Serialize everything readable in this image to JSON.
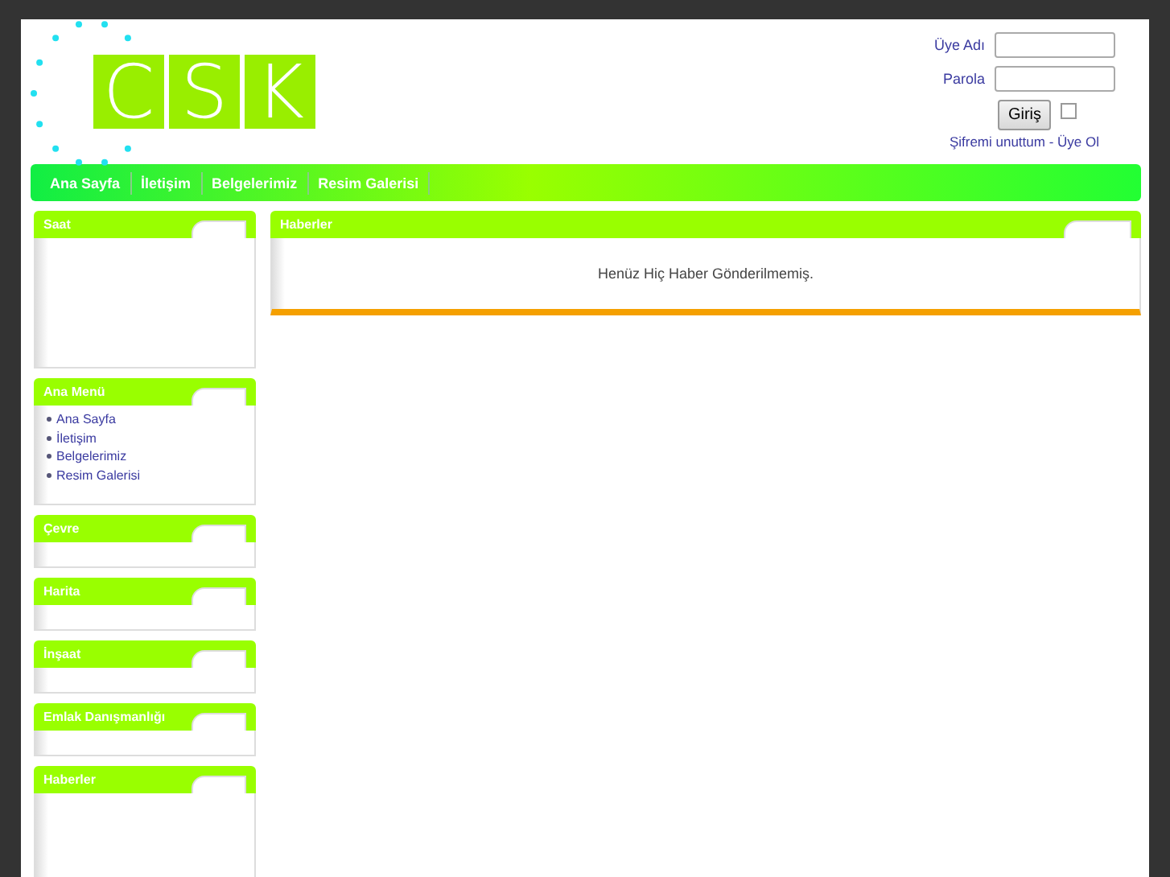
{
  "logo": {
    "letters": [
      "C",
      "S",
      "K"
    ]
  },
  "login": {
    "username_label": "Üye Adı",
    "password_label": "Parola",
    "button": "Giriş",
    "remember_checked": false,
    "links": [
      "Şifremi unuttum - Üye Ol"
    ]
  },
  "nav": [
    "Ana Sayfa",
    "İletişim",
    "Belgelerimiz",
    "Resim Galerisi"
  ],
  "sidebar": [
    {
      "title": "Saat",
      "kind": "tall"
    },
    {
      "title": "Ana Menü",
      "kind": "menu",
      "items": [
        "Ana Sayfa",
        "İletişim",
        "Belgelerimiz",
        "Resim Galerisi"
      ]
    },
    {
      "title": "Çevre",
      "kind": "short"
    },
    {
      "title": "Harita",
      "kind": "short"
    },
    {
      "title": "İnşaat",
      "kind": "short"
    },
    {
      "title": "Emlak Danışmanlığı",
      "kind": "short"
    },
    {
      "title": "Haberler",
      "kind": "tall"
    }
  ],
  "main": {
    "title": "Haberler",
    "message": "Henüz Hiç Haber Gönderilmemiş."
  }
}
